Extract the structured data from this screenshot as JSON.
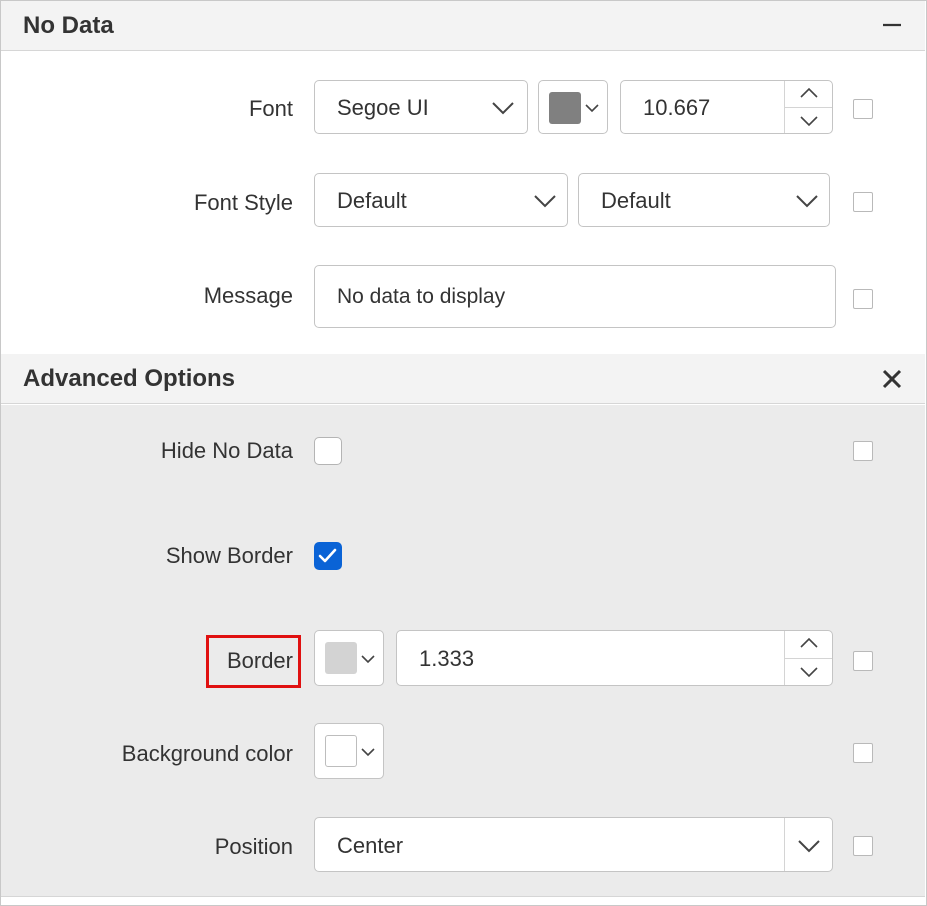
{
  "section_no_data": {
    "title": "No Data",
    "collapse_icon": "minus-icon",
    "font": {
      "label": "Font",
      "family_value": "Segoe UI",
      "color": "#808080",
      "size_value": "10.667"
    },
    "font_style": {
      "label": "Font Style",
      "style_value": "Default",
      "weight_value": "Default"
    },
    "message": {
      "label": "Message",
      "value": "No data to display"
    }
  },
  "section_advanced": {
    "title": "Advanced Options",
    "close_icon": "close-icon",
    "hide_no_data": {
      "label": "Hide No Data",
      "checked": false
    },
    "show_border": {
      "label": "Show Border",
      "checked": true
    },
    "border": {
      "label": "Border",
      "color": "#d3d3d3",
      "width_value": "1.333"
    },
    "background_color": {
      "label": "Background color",
      "color": "#ffffff"
    },
    "position": {
      "label": "Position",
      "value": "Center"
    }
  },
  "colors": {
    "accent": "#0a63d6",
    "highlight": "#e01010",
    "header_bg": "#f3f3f3",
    "advanced_bg": "#ebebeb"
  }
}
